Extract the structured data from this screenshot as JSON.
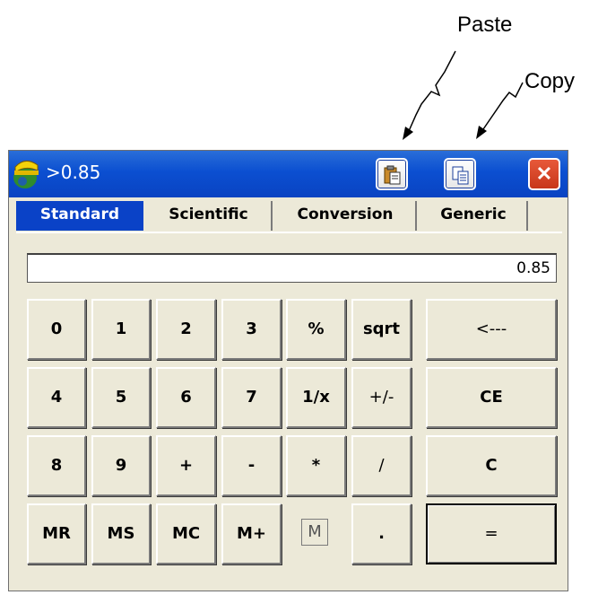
{
  "annotations": {
    "paste": "Paste",
    "copy": "Copy"
  },
  "window": {
    "title": ">0.85",
    "close_label": "✕"
  },
  "tabs": [
    {
      "label": "Standard",
      "active": true
    },
    {
      "label": "Scientific",
      "active": false
    },
    {
      "label": "Conversion",
      "active": false
    },
    {
      "label": "Generic",
      "active": false
    }
  ],
  "display": {
    "value": "0.85"
  },
  "keys": {
    "row1": [
      "0",
      "1",
      "2",
      "3",
      "%",
      "sqrt",
      "<---"
    ],
    "row2": [
      "4",
      "5",
      "6",
      "7",
      "1/x",
      "+/-",
      "CE"
    ],
    "row3": [
      "8",
      "9",
      "+",
      "-",
      "*",
      "/",
      "C"
    ],
    "row4": [
      "MR",
      "MS",
      "MC",
      "M+",
      ".",
      "="
    ]
  },
  "memory_indicator": "M",
  "icons": {
    "app": "surveyor-helmet-icon",
    "paste": "paste-icon",
    "copy": "copy-icon",
    "close": "close-icon"
  },
  "colors": {
    "titlebar": "#0b4fd1",
    "active_tab": "#0a42c7",
    "close_button": "#d84320",
    "window_bg": "#ece9d8"
  }
}
